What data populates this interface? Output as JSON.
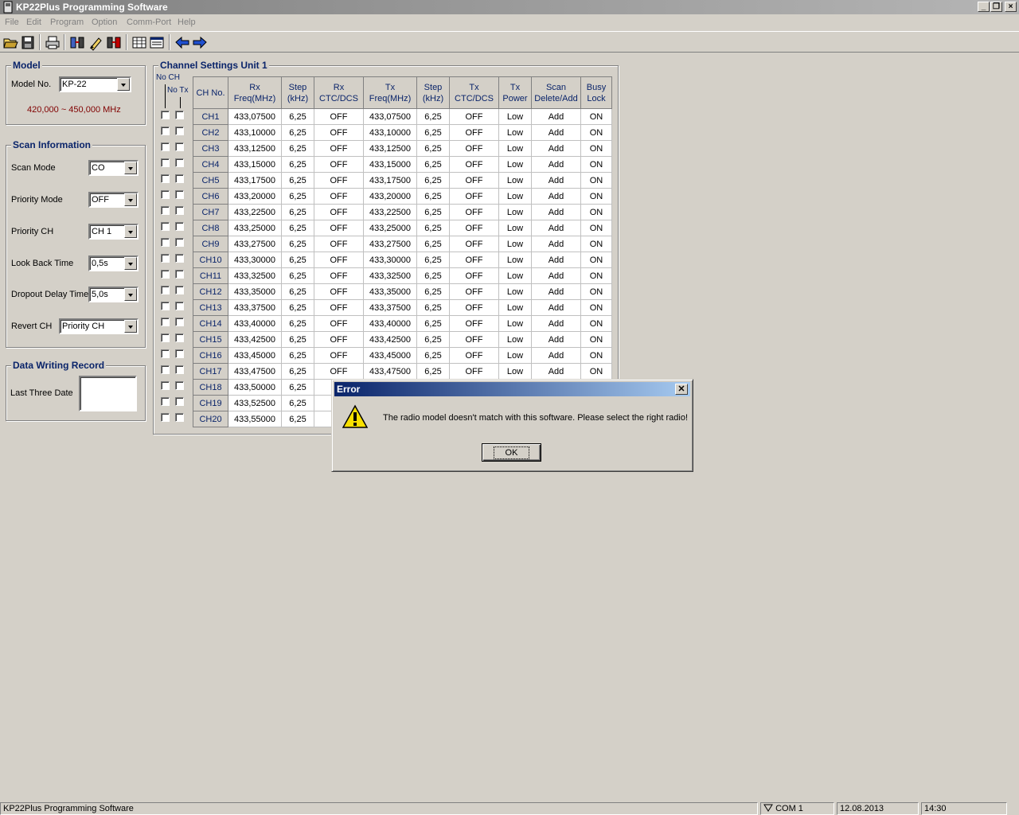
{
  "window": {
    "title": "KP22Plus Programming Software"
  },
  "menu": [
    "File",
    "Edit",
    "Program",
    "Option",
    "Comm-Port",
    "Help"
  ],
  "toolbar": [
    "open-icon",
    "save-icon",
    "print-icon",
    "read-radio-icon",
    "write-radio-icon",
    "clone-icon",
    "grid-view-icon",
    "list-view-icon",
    "back-icon",
    "forward-icon"
  ],
  "model": {
    "title": "Model",
    "model_no_label": "Model No.",
    "model_no_value": "KP-22",
    "freq_range": "420,000 ~ 450,000 MHz"
  },
  "scan": {
    "title": "Scan Information",
    "fields": [
      {
        "label": "Scan Mode",
        "value": "CO"
      },
      {
        "label": "Priority Mode",
        "value": "OFF"
      },
      {
        "label": "Priority CH",
        "value": "CH 1"
      },
      {
        "label": "Look Back Time",
        "value": "0,5s"
      },
      {
        "label": "Dropout Delay Time",
        "value": "5,0s"
      },
      {
        "label": "Revert CH",
        "value": "Priority CH"
      }
    ]
  },
  "record": {
    "title": "Data Writing Record",
    "last_label": "Last Three Date"
  },
  "channels": {
    "title": "Channel Settings Unit 1",
    "no_ch": "No CH",
    "no_tx": "No Tx",
    "headers": [
      [
        "CH No.",
        ""
      ],
      [
        "Rx",
        "Freq(MHz)"
      ],
      [
        "Step",
        "(kHz)"
      ],
      [
        "Rx",
        "CTC/DCS"
      ],
      [
        "Tx",
        "Freq(MHz)"
      ],
      [
        "Step",
        "(kHz)"
      ],
      [
        "Tx",
        "CTC/DCS"
      ],
      [
        "Tx",
        "Power"
      ],
      [
        "Scan",
        "Delete/Add"
      ],
      [
        "Busy",
        "Lock"
      ]
    ],
    "rows": [
      [
        "CH1",
        "433,07500",
        "6,25",
        "OFF",
        "433,07500",
        "6,25",
        "OFF",
        "Low",
        "Add",
        "ON"
      ],
      [
        "CH2",
        "433,10000",
        "6,25",
        "OFF",
        "433,10000",
        "6,25",
        "OFF",
        "Low",
        "Add",
        "ON"
      ],
      [
        "CH3",
        "433,12500",
        "6,25",
        "OFF",
        "433,12500",
        "6,25",
        "OFF",
        "Low",
        "Add",
        "ON"
      ],
      [
        "CH4",
        "433,15000",
        "6,25",
        "OFF",
        "433,15000",
        "6,25",
        "OFF",
        "Low",
        "Add",
        "ON"
      ],
      [
        "CH5",
        "433,17500",
        "6,25",
        "OFF",
        "433,17500",
        "6,25",
        "OFF",
        "Low",
        "Add",
        "ON"
      ],
      [
        "CH6",
        "433,20000",
        "6,25",
        "OFF",
        "433,20000",
        "6,25",
        "OFF",
        "Low",
        "Add",
        "ON"
      ],
      [
        "CH7",
        "433,22500",
        "6,25",
        "OFF",
        "433,22500",
        "6,25",
        "OFF",
        "Low",
        "Add",
        "ON"
      ],
      [
        "CH8",
        "433,25000",
        "6,25",
        "OFF",
        "433,25000",
        "6,25",
        "OFF",
        "Low",
        "Add",
        "ON"
      ],
      [
        "CH9",
        "433,27500",
        "6,25",
        "OFF",
        "433,27500",
        "6,25",
        "OFF",
        "Low",
        "Add",
        "ON"
      ],
      [
        "CH10",
        "433,30000",
        "6,25",
        "OFF",
        "433,30000",
        "6,25",
        "OFF",
        "Low",
        "Add",
        "ON"
      ],
      [
        "CH11",
        "433,32500",
        "6,25",
        "OFF",
        "433,32500",
        "6,25",
        "OFF",
        "Low",
        "Add",
        "ON"
      ],
      [
        "CH12",
        "433,35000",
        "6,25",
        "OFF",
        "433,35000",
        "6,25",
        "OFF",
        "Low",
        "Add",
        "ON"
      ],
      [
        "CH13",
        "433,37500",
        "6,25",
        "OFF",
        "433,37500",
        "6,25",
        "OFF",
        "Low",
        "Add",
        "ON"
      ],
      [
        "CH14",
        "433,40000",
        "6,25",
        "OFF",
        "433,40000",
        "6,25",
        "OFF",
        "Low",
        "Add",
        "ON"
      ],
      [
        "CH15",
        "433,42500",
        "6,25",
        "OFF",
        "433,42500",
        "6,25",
        "OFF",
        "Low",
        "Add",
        "ON"
      ],
      [
        "CH16",
        "433,45000",
        "6,25",
        "OFF",
        "433,45000",
        "6,25",
        "OFF",
        "Low",
        "Add",
        "ON"
      ],
      [
        "CH17",
        "433,47500",
        "6,25",
        "OFF",
        "433,47500",
        "6,25",
        "OFF",
        "Low",
        "Add",
        "ON"
      ],
      [
        "CH18",
        "433,50000",
        "6,25",
        "",
        "",
        "",
        "",
        "",
        "",
        ""
      ],
      [
        "CH19",
        "433,52500",
        "6,25",
        "",
        "",
        "",
        "",
        "",
        "",
        ""
      ],
      [
        "CH20",
        "433,55000",
        "6,25",
        "",
        "",
        "",
        "",
        "",
        "",
        ""
      ]
    ]
  },
  "dialog": {
    "title": "Error",
    "message": "The radio model doesn't match with this software. Please select the right radio!",
    "ok": "OK",
    "icon": "warning-icon"
  },
  "status": {
    "app": "KP22Plus Programming Software",
    "port": "COM 1",
    "date": "12.08.2013",
    "time": "14:30"
  }
}
